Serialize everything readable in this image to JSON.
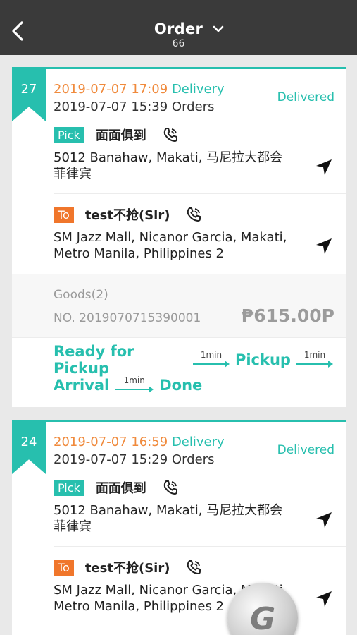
{
  "header": {
    "title": "Order",
    "count": "66"
  },
  "orders": [
    {
      "index": "27",
      "delivery_time": "2019-07-07 17:09",
      "delivery_tag": "Delivery",
      "order_time": "2019-07-07 15:39 Orders",
      "status": "Delivered",
      "pickup": {
        "badge": "Pick",
        "name": "面面俱到",
        "address_line1": "5012 Banahaw, Makati, 马尼拉大都会",
        "address_line2": "菲律宾"
      },
      "dropoff": {
        "badge": "To",
        "name": "test不抢(Sir)",
        "address_line1": "SM Jazz Mall, Nicanor Garcia, Makati,",
        "address_line2": "Metro Manila, Philippines 2"
      },
      "goods": "Goods(2)",
      "order_no": "NO. 2019070715390001",
      "price": "₱615.00P",
      "steps": [
        "Ready for Pickup",
        "Pickup",
        "Arrival",
        "Done"
      ],
      "step_durations": [
        "1min",
        "1min",
        "1min"
      ]
    },
    {
      "index": "24",
      "delivery_time": "2019-07-07 16:59",
      "delivery_tag": "Delivery",
      "order_time": "2019-07-07 15:29 Orders",
      "status": "Delivered",
      "pickup": {
        "badge": "Pick",
        "name": "面面俱到",
        "address_line1": "5012 Banahaw, Makati, 马尼拉大都会",
        "address_line2": "菲律宾"
      },
      "dropoff": {
        "badge": "To",
        "name": "test不抢(Sir)",
        "address_line1": "SM Jazz Mall, Nicanor Garcia, Makati,",
        "address_line2": "Metro Manila, Philippines 2"
      }
    }
  ],
  "floating_button": {
    "label": "G"
  },
  "icons": {
    "back": "back-icon",
    "dropdown": "chevron-down-icon",
    "phone": "phone-icon",
    "navigate": "navigation-arrow-icon"
  },
  "colors": {
    "accent": "#27bfae",
    "orange": "#f08a3c",
    "to_badge": "#f0762b",
    "header_bg": "#3a3a3a"
  }
}
